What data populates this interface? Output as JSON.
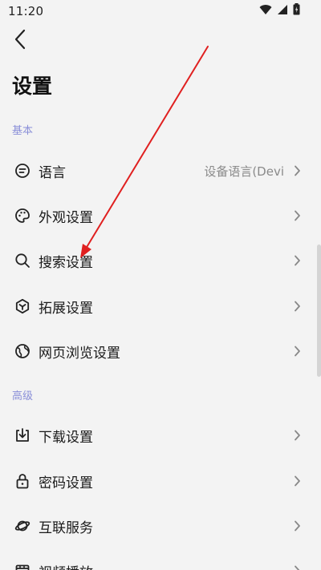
{
  "status_bar": {
    "time": "11:20",
    "icons": [
      "wifi-icon",
      "signal-icon",
      "battery-icon"
    ]
  },
  "header": {
    "back_icon": "chevron-left-icon",
    "title": "设置"
  },
  "sections": [
    {
      "header": "基本",
      "items": [
        {
          "label": "语言",
          "value": "设备语言(Devi",
          "icon": "message-icon"
        },
        {
          "label": "外观设置",
          "icon": "palette-icon"
        },
        {
          "label": "搜索设置",
          "icon": "search-icon"
        },
        {
          "label": "拓展设置",
          "icon": "extension-icon"
        },
        {
          "label": "网页浏览设置",
          "icon": "globe-icon"
        }
      ]
    },
    {
      "header": "高级",
      "items": [
        {
          "label": "下载设置",
          "icon": "download-icon"
        },
        {
          "label": "密码设置",
          "icon": "lock-icon"
        },
        {
          "label": "互联服务",
          "icon": "planet-icon"
        },
        {
          "label": "视频播放",
          "icon": "video-icon"
        }
      ]
    }
  ],
  "colors": {
    "background": "#f3f3f3",
    "section_header": "#8a8fd8",
    "annotation_arrow": "#e02020"
  }
}
